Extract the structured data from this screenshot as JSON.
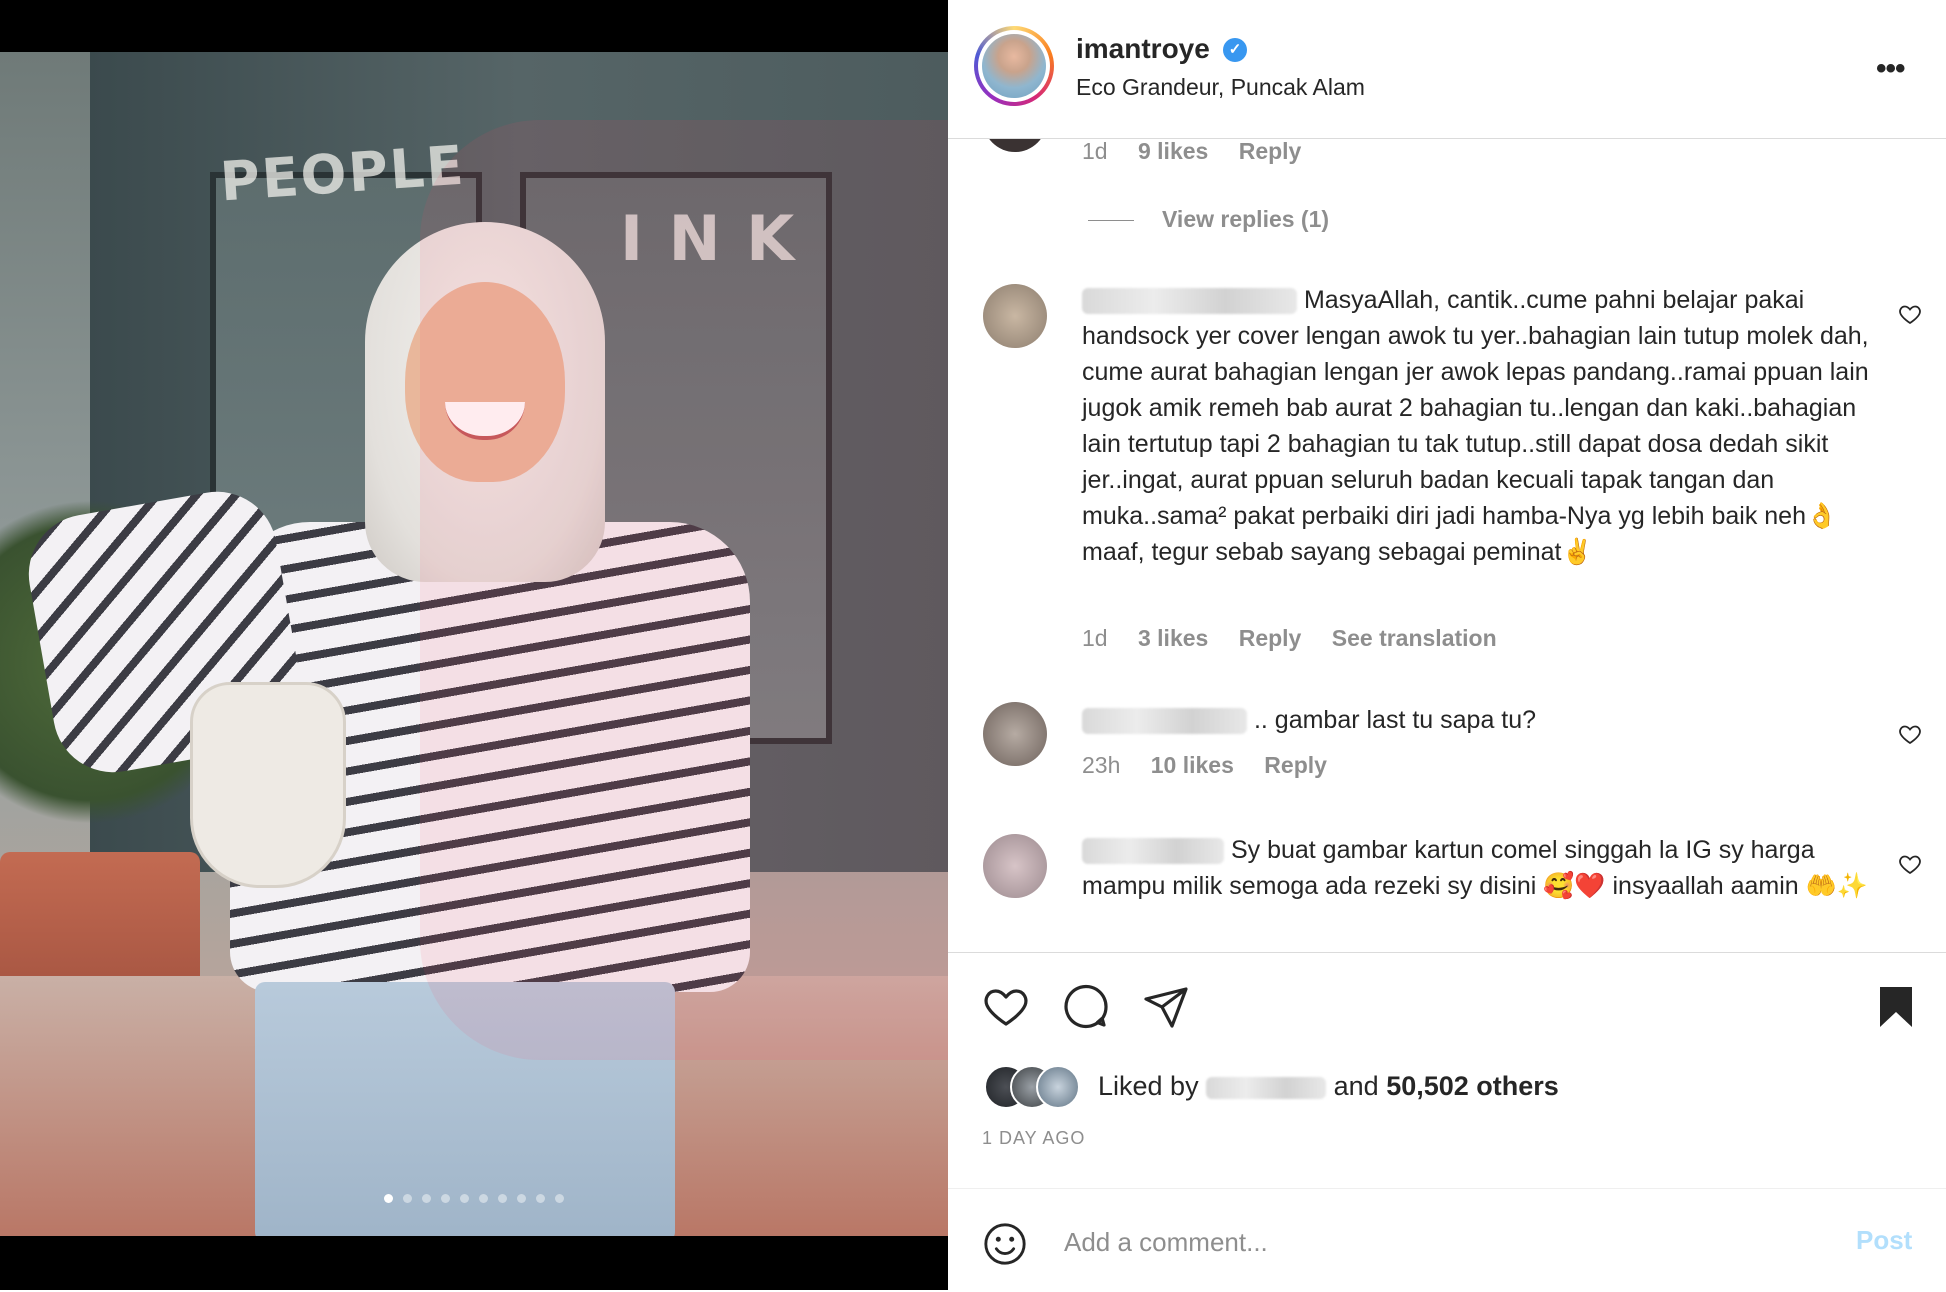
{
  "post": {
    "image_alt": "",
    "carousel": {
      "total": 10,
      "active_index": 0
    }
  },
  "header": {
    "username": "imantroye",
    "verified_glyph": "✓",
    "location": "Eco Grandeur, Puncak Alam",
    "more_glyph": "•••"
  },
  "comments": {
    "partial_top": {
      "time": "1d",
      "likes": "9 likes",
      "reply": "Reply"
    },
    "view_replies": "View replies (1)",
    "items": [
      {
        "text": "MasyaAllah, cantik..cume pahni belajar pakai handsock yer cover lengan awok tu yer..bahagian lain tutup molek dah, cume aurat bahagian lengan jer awok lepas pandang..ramai ppuan lain jugok amik remeh bab aurat 2 bahagian tu..lengan dan kaki..bahagian lain tertutup tapi 2 bahagian tu tak tutup..still dapat dosa dedah sikit jer..ingat, aurat ppuan seluruh badan kecuali tapak tangan dan muka..sama² pakat perbaiki diri jadi hamba-Nya yg lebih baik neh👌maaf, tegur sebab sayang sebagai peminat✌",
        "time": "1d",
        "likes": "3 likes",
        "reply": "Reply",
        "translate": "See translation"
      },
      {
        "text": ".. gambar last tu sapa tu?",
        "time": "23h",
        "likes": "10 likes",
        "reply": "Reply"
      },
      {
        "text": "Sy buat gambar kartun comel singgah la IG sy harga mampu milik semoga ada rezeki sy disini 🥰❤️ insyaallah aamin 🤲✨"
      }
    ]
  },
  "actions": {
    "liked_prefix": "Liked by",
    "liked_and": "and",
    "liked_others": "50,502 others",
    "time_ago": "1 DAY AGO",
    "comment_placeholder": "Add a comment...",
    "post_label": "Post"
  },
  "colors": {
    "verified_blue": "#3897f0",
    "post_disabled": "#b2dffc",
    "meta_gray": "#8e8e8e"
  },
  "icons": [
    "more-icon",
    "heart-icon",
    "comment-icon",
    "share-icon",
    "bookmark-icon",
    "emoji-icon",
    "verified-icon"
  ]
}
